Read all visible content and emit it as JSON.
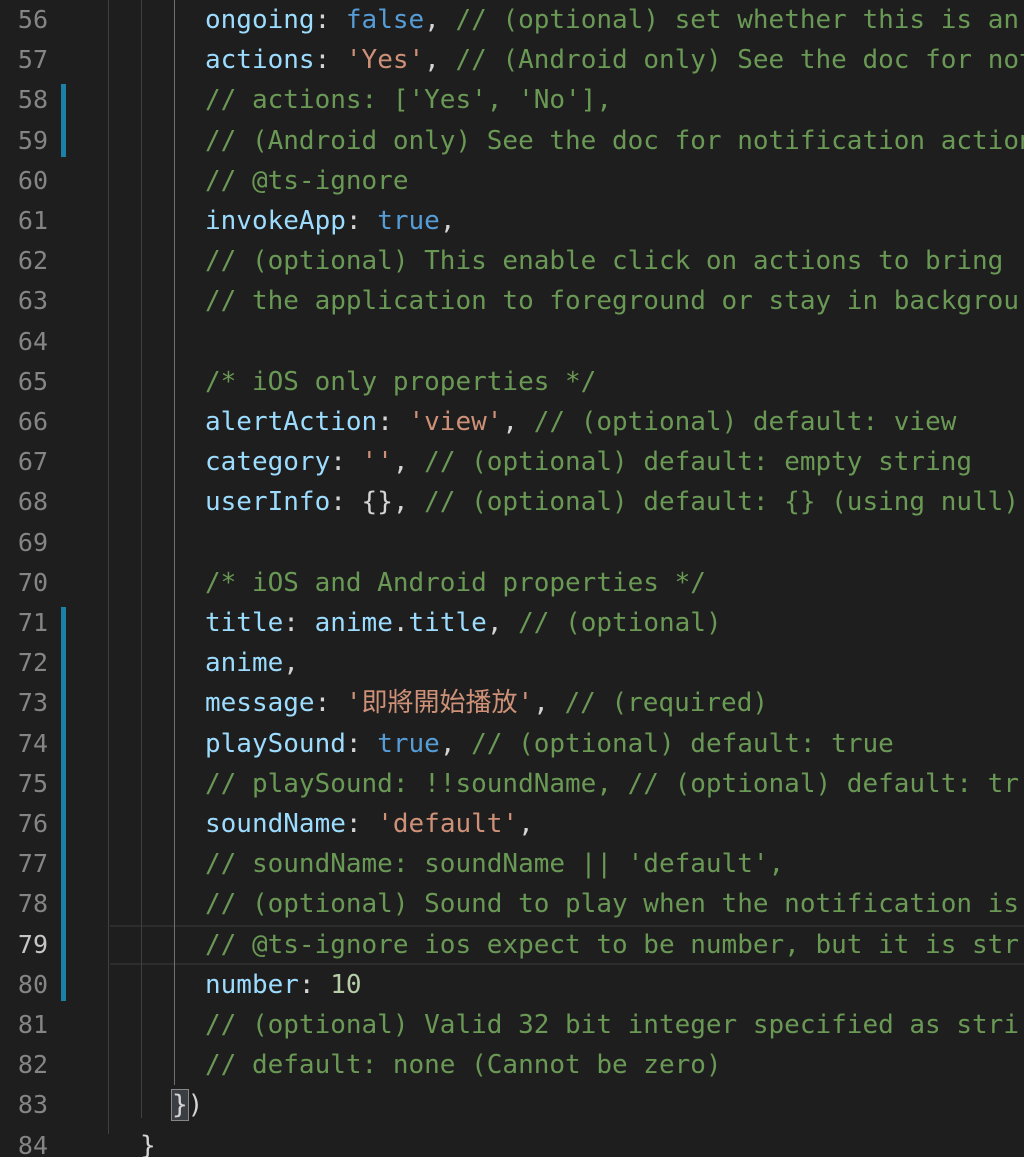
{
  "editor": {
    "colors": {
      "background": "#1e1e1e",
      "property": "#9cdcfe",
      "keyword": "#569cd6",
      "string": "#ce9178",
      "number": "#b5cea8",
      "comment": "#6a9955",
      "punctuation": "#d4d4d4",
      "line_number": "#858585",
      "diff_marker": "#1b81a8"
    },
    "current_line": 79,
    "modified_lines": [
      58,
      59,
      71,
      72,
      73,
      74,
      75,
      76,
      77,
      78,
      79,
      80
    ],
    "lines": [
      {
        "n": "56",
        "tokens": [
          [
            "p",
            "ongoing"
          ],
          [
            "c",
            ": "
          ],
          [
            "b",
            "false"
          ],
          [
            "c",
            ", "
          ],
          [
            "m",
            "// (optional) set whether this is an"
          ]
        ]
      },
      {
        "n": "57",
        "tokens": [
          [
            "p",
            "actions"
          ],
          [
            "c",
            ": "
          ],
          [
            "s",
            "'Yes'"
          ],
          [
            "c",
            ", "
          ],
          [
            "m",
            "// (Android only) See the doc for not"
          ]
        ]
      },
      {
        "n": "58",
        "tokens": [
          [
            "m",
            "// actions: ['Yes', 'No'],"
          ]
        ]
      },
      {
        "n": "59",
        "tokens": [
          [
            "m",
            "// (Android only) See the doc for notification actions"
          ]
        ]
      },
      {
        "n": "60",
        "tokens": [
          [
            "m",
            "// @ts-ignore"
          ]
        ]
      },
      {
        "n": "61",
        "tokens": [
          [
            "p",
            "invokeApp"
          ],
          [
            "c",
            ": "
          ],
          [
            "b",
            "true"
          ],
          [
            "c",
            ","
          ]
        ]
      },
      {
        "n": "62",
        "tokens": [
          [
            "m",
            "// (optional) This enable click on actions to bring"
          ]
        ]
      },
      {
        "n": "63",
        "tokens": [
          [
            "m",
            "// the application to foreground or stay in backgrou"
          ]
        ]
      },
      {
        "n": "64",
        "tokens": []
      },
      {
        "n": "65",
        "tokens": [
          [
            "m",
            "/* iOS only properties */"
          ]
        ]
      },
      {
        "n": "66",
        "tokens": [
          [
            "p",
            "alertAction"
          ],
          [
            "c",
            ": "
          ],
          [
            "s",
            "'view'"
          ],
          [
            "c",
            ", "
          ],
          [
            "m",
            "// (optional) default: view"
          ]
        ]
      },
      {
        "n": "67",
        "tokens": [
          [
            "p",
            "category"
          ],
          [
            "c",
            ": "
          ],
          [
            "s",
            "''"
          ],
          [
            "c",
            ", "
          ],
          [
            "m",
            "// (optional) default: empty string"
          ]
        ]
      },
      {
        "n": "68",
        "tokens": [
          [
            "p",
            "userInfo"
          ],
          [
            "c",
            ": {}, "
          ],
          [
            "m",
            "// (optional) default: {} (using null)"
          ]
        ]
      },
      {
        "n": "69",
        "tokens": []
      },
      {
        "n": "70",
        "tokens": [
          [
            "m",
            "/* iOS and Android properties */"
          ]
        ]
      },
      {
        "n": "71",
        "tokens": [
          [
            "p",
            "title"
          ],
          [
            "c",
            ": "
          ],
          [
            "p",
            "anime"
          ],
          [
            "c",
            "."
          ],
          [
            "p",
            "title"
          ],
          [
            "c",
            ", "
          ],
          [
            "m",
            "// (optional)"
          ]
        ]
      },
      {
        "n": "72",
        "tokens": [
          [
            "p",
            "anime"
          ],
          [
            "c",
            ","
          ]
        ]
      },
      {
        "n": "73",
        "tokens": [
          [
            "p",
            "message"
          ],
          [
            "c",
            ": "
          ],
          [
            "s",
            "'即將開始播放'"
          ],
          [
            "c",
            ", "
          ],
          [
            "m",
            "// (required)"
          ]
        ]
      },
      {
        "n": "74",
        "tokens": [
          [
            "p",
            "playSound"
          ],
          [
            "c",
            ": "
          ],
          [
            "b",
            "true"
          ],
          [
            "c",
            ", "
          ],
          [
            "m",
            "// (optional) default: true"
          ]
        ]
      },
      {
        "n": "75",
        "tokens": [
          [
            "m",
            "// playSound: !!soundName, // (optional) default: tr"
          ]
        ]
      },
      {
        "n": "76",
        "tokens": [
          [
            "p",
            "soundName"
          ],
          [
            "c",
            ": "
          ],
          [
            "s",
            "'default'"
          ],
          [
            "c",
            ","
          ]
        ]
      },
      {
        "n": "77",
        "tokens": [
          [
            "m",
            "// soundName: soundName || 'default',"
          ]
        ]
      },
      {
        "n": "78",
        "tokens": [
          [
            "m",
            "// (optional) Sound to play when the notification is"
          ]
        ]
      },
      {
        "n": "79",
        "tokens": [
          [
            "m",
            "// @ts-ignore ios expect to be number, but it is str"
          ]
        ]
      },
      {
        "n": "80",
        "tokens": [
          [
            "p",
            "number"
          ],
          [
            "c",
            ": "
          ],
          [
            "n",
            "10"
          ]
        ]
      },
      {
        "n": "81",
        "tokens": [
          [
            "m",
            "// (optional) Valid 32 bit integer specified as stri"
          ]
        ]
      },
      {
        "n": "82",
        "tokens": [
          [
            "m",
            "// default: none (Cannot be zero)"
          ]
        ]
      },
      {
        "n": "83",
        "tokens": [
          [
            "x",
            "}"
          ],
          [
            "c",
            ")"
          ]
        ]
      },
      {
        "n": "84",
        "tokens": [
          [
            "c",
            "}"
          ]
        ]
      }
    ]
  }
}
